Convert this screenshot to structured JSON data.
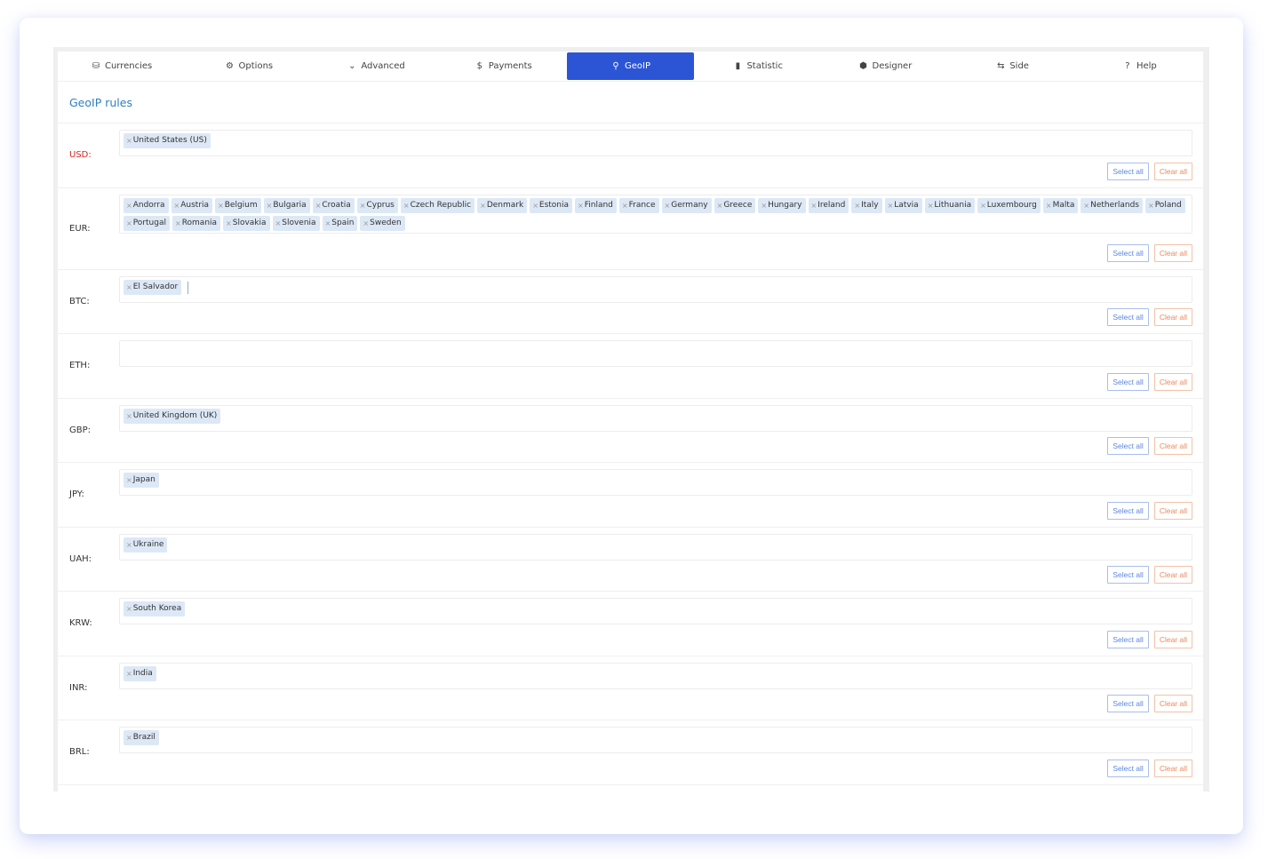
{
  "tabs": [
    {
      "label": "Currencies",
      "icon": "coins-icon",
      "glyph": "⛁",
      "active": false
    },
    {
      "label": "Options",
      "icon": "gear-icon",
      "glyph": "⚙",
      "active": false
    },
    {
      "label": "Advanced",
      "icon": "chevron-down-icon",
      "glyph": "⌄",
      "active": false
    },
    {
      "label": "Payments",
      "icon": "dollar-icon",
      "glyph": "$",
      "active": false
    },
    {
      "label": "GeoIP",
      "icon": "map-pin-icon",
      "glyph": "⚲",
      "active": true
    },
    {
      "label": "Statistic",
      "icon": "bar-chart-icon",
      "glyph": "▮",
      "active": false
    },
    {
      "label": "Designer",
      "icon": "cube-icon",
      "glyph": "⬢",
      "active": false
    },
    {
      "label": "Side",
      "icon": "swap-icon",
      "glyph": "⇆",
      "active": false
    },
    {
      "label": "Help",
      "icon": "question-circle-icon",
      "glyph": "?",
      "active": false
    }
  ],
  "section_title": "GeoIP rules",
  "buttons": {
    "select_all": "Select all",
    "clear_all": "Clear all"
  },
  "tag_remove_glyph": "×",
  "colors": {
    "accent": "#2c55d6",
    "title": "#2c7fc4",
    "required": "#dd2222",
    "select_btn": "#5b87e6",
    "clear_btn": "#ec8a5c",
    "tag_bg": "#dde8f6"
  },
  "rules": [
    {
      "currency": "USD:",
      "required": true,
      "countries": [
        "United States (US)"
      ]
    },
    {
      "currency": "EUR:",
      "required": false,
      "countries": [
        "Andorra",
        "Austria",
        "Belgium",
        "Bulgaria",
        "Croatia",
        "Cyprus",
        "Czech Republic",
        "Denmark",
        "Estonia",
        "Finland",
        "France",
        "Germany",
        "Greece",
        "Hungary",
        "Ireland",
        "Italy",
        "Latvia",
        "Lithuania",
        "Luxembourg",
        "Malta",
        "Netherlands",
        "Poland",
        "Portugal",
        "Romania",
        "Slovakia",
        "Slovenia",
        "Spain",
        "Sweden"
      ]
    },
    {
      "currency": "BTC:",
      "required": false,
      "countries": [
        "El Salvador"
      ],
      "focused": true
    },
    {
      "currency": "ETH:",
      "required": false,
      "countries": []
    },
    {
      "currency": "GBP:",
      "required": false,
      "countries": [
        "United Kingdom (UK)"
      ]
    },
    {
      "currency": "JPY:",
      "required": false,
      "countries": [
        "Japan"
      ]
    },
    {
      "currency": "UAH:",
      "required": false,
      "countries": [
        "Ukraine"
      ]
    },
    {
      "currency": "KRW:",
      "required": false,
      "countries": [
        "South Korea"
      ]
    },
    {
      "currency": "INR:",
      "required": false,
      "countries": [
        "India"
      ]
    },
    {
      "currency": "BRL:",
      "required": false,
      "countries": [
        "Brazil"
      ]
    }
  ]
}
